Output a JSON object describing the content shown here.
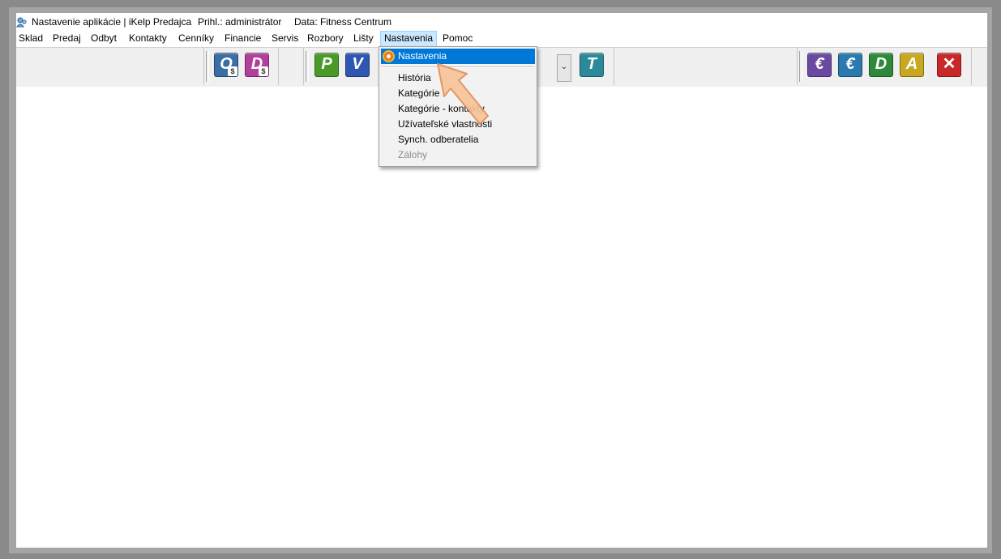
{
  "titlebar": {
    "app_title": "Nastavenie aplikácie | iKelp Predajca",
    "user": "Prihl.: administrátor",
    "data_source": "Data: Fitness Centrum"
  },
  "menubar": {
    "items": [
      "Sklad",
      "Predaj",
      "Odbyt",
      "Kontakty",
      "Cenníky",
      "Financie",
      "Servis",
      "Rozbory",
      "Lišty",
      "Nastavenia",
      "Pomoc"
    ],
    "active": "Nastavenia"
  },
  "toolbar": {
    "buttons": [
      {
        "letter": "O",
        "badge": "$",
        "color": "#3a6ea5"
      },
      {
        "letter": "D",
        "badge": "$",
        "color": "#b0409a"
      },
      {
        "letter": "P",
        "badge": "",
        "color": "#4a9a2a"
      },
      {
        "letter": "V",
        "badge": "",
        "color": "#2f56b0"
      },
      {
        "letter": "T",
        "badge": "",
        "color": "#2a8a9a"
      },
      {
        "letter": "€",
        "badge": "",
        "color": "#6a4aa0"
      },
      {
        "letter": "€",
        "badge": "",
        "color": "#2a7ab0"
      },
      {
        "letter": "D",
        "badge": "",
        "color": "#2e8a3a"
      },
      {
        "letter": "A",
        "badge": "",
        "color": "#c8a820"
      },
      {
        "letter": "✕",
        "badge": "",
        "color": "#c82828"
      }
    ],
    "dropdown_arrow": "⌄"
  },
  "popup_menu": {
    "items": [
      {
        "label": "Nastavenia",
        "state": "highlighted",
        "icon": "gear-icon"
      },
      {
        "label": "História",
        "state": "normal"
      },
      {
        "label": "Kategórie",
        "state": "normal"
      },
      {
        "label": "Kategórie - kontakty",
        "state": "normal"
      },
      {
        "label": "Užívateľské vlastnosti",
        "state": "normal"
      },
      {
        "label": "Synch. odberatelia",
        "state": "normal"
      },
      {
        "label": "Zálohy",
        "state": "disabled"
      }
    ]
  },
  "colors": {
    "highlight": "#0078d7",
    "menu_active_bg": "#cce8ff",
    "pointer_fill": "#f8c49a",
    "pointer_stroke": "#e0905a"
  }
}
